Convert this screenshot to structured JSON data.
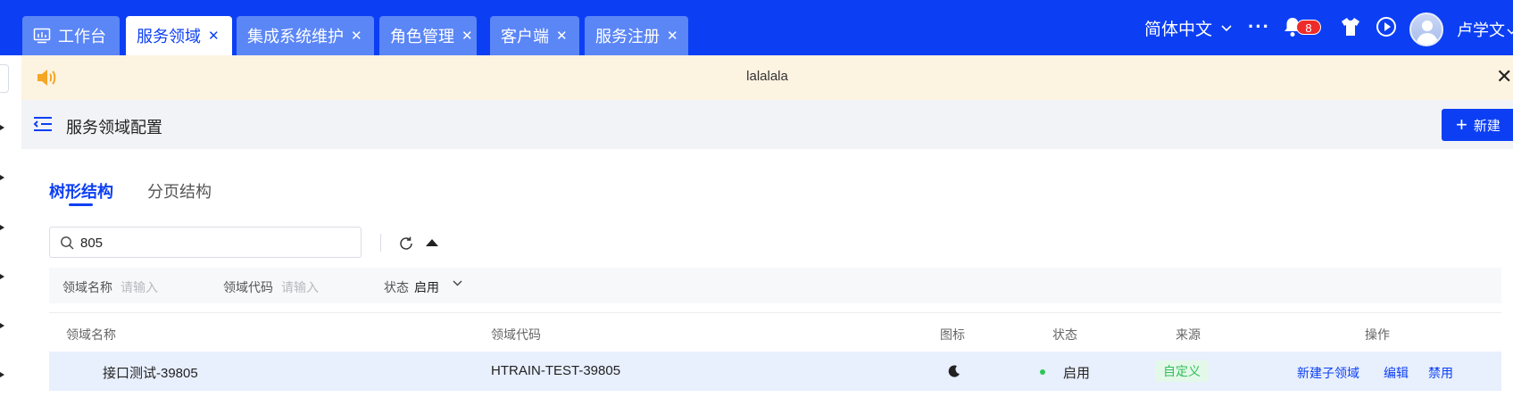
{
  "tabs": [
    {
      "label": "工作台",
      "icon": "monitor-chart-icon",
      "closable": false,
      "active": false
    },
    {
      "label": "服务领域",
      "closable": true,
      "active": true
    },
    {
      "label": "集成系统维护",
      "closable": true,
      "active": false
    },
    {
      "label": "角色管理",
      "closable": true,
      "active": false
    },
    {
      "label": "客户端",
      "closable": true,
      "active": false
    },
    {
      "label": "服务注册",
      "closable": true,
      "active": false
    }
  ],
  "header": {
    "language": "简体中文",
    "more_label": "···",
    "notification_count": "8",
    "username": "卢学文"
  },
  "notice": {
    "message": "lalalala"
  },
  "page": {
    "title": "服务领域配置",
    "new_button_label": "新建",
    "new_button_plus": "+"
  },
  "subtabs": [
    {
      "label": "树形结构",
      "active": true
    },
    {
      "label": "分页结构",
      "active": false
    }
  ],
  "search": {
    "value": "805"
  },
  "filters": {
    "name_label": "领域名称",
    "name_placeholder": "请输入",
    "code_label": "领域代码",
    "code_placeholder": "请输入",
    "status_label": "状态",
    "status_value": "启用"
  },
  "table": {
    "columns": [
      "领域名称",
      "领域代码",
      "图标",
      "状态",
      "来源",
      "操作"
    ],
    "rows": [
      {
        "name": "接口测试-39805",
        "code": "HTRAIN-TEST-39805",
        "icon": "moon-icon",
        "status": "启用",
        "source": "自定义",
        "actions": [
          "新建子领域",
          "编辑",
          "禁用"
        ]
      }
    ]
  },
  "colors": {
    "primary": "#0c3ff4",
    "tab_inactive": "#5b86f6",
    "notice_bg": "#fdf3e1",
    "status_green": "#2ec55a",
    "badge_red": "#ee2a2a",
    "row_selected": "#e8effd"
  }
}
